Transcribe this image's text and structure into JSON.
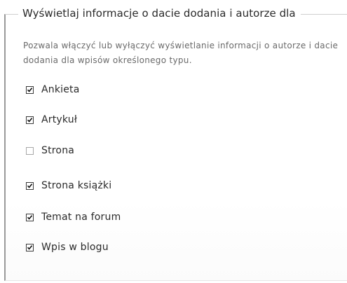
{
  "legend": "Wyświetlaj informacje o dacie dodania i autorze dla",
  "description": "Pozwala włączyć lub wyłączyć wyświetlanie informacji o autorze i dacie dodania dla wpisów określonego typu.",
  "options": [
    {
      "label": "Ankieta",
      "checked": true
    },
    {
      "label": "Artykuł",
      "checked": true
    },
    {
      "label": "Strona",
      "checked": false
    },
    {
      "label": "Strona książki",
      "checked": true
    },
    {
      "label": "Temat na forum",
      "checked": true
    },
    {
      "label": "Wpis w blogu",
      "checked": true
    }
  ]
}
